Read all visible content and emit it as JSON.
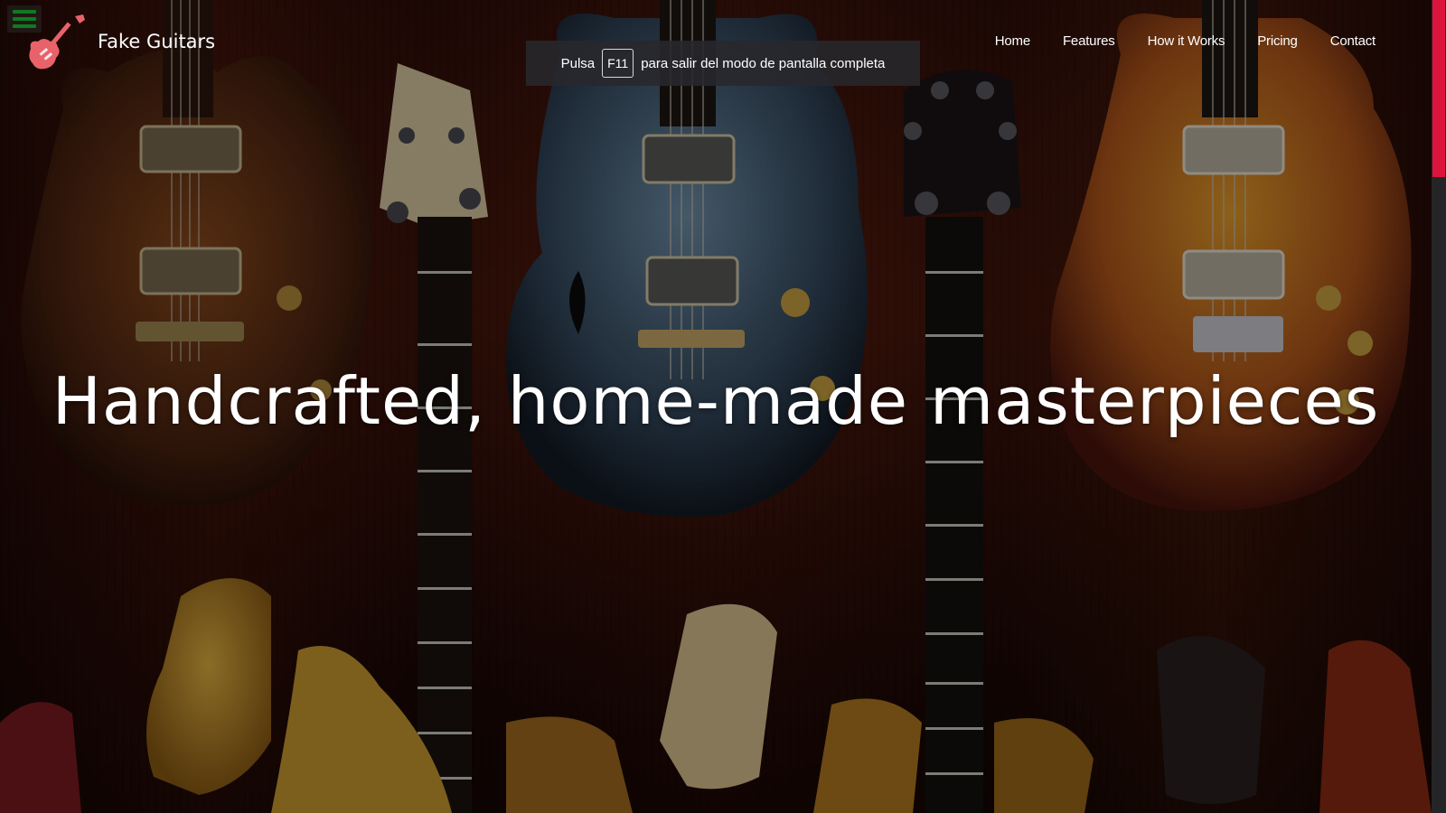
{
  "brand": {
    "name": "Fake Guitars",
    "logo_icon": "guitar-icon"
  },
  "menu": {
    "icon": "hamburger-menu-icon",
    "icon_color": "#0f7a1e"
  },
  "nav": {
    "items": [
      {
        "label": "Home"
      },
      {
        "label": "Features"
      },
      {
        "label": "How it Works"
      },
      {
        "label": "Pricing"
      },
      {
        "label": "Contact"
      }
    ]
  },
  "fullscreen_notice": {
    "prefix": "Pulsa",
    "key": "F11",
    "suffix": "para salir del modo de pantalla completa"
  },
  "hero": {
    "title": "Handcrafted, home-made masterpieces",
    "background": "guitar-wall-photo"
  },
  "colors": {
    "accent": "#dc143c",
    "logo": "#e8626a",
    "text": "#ffffff"
  }
}
